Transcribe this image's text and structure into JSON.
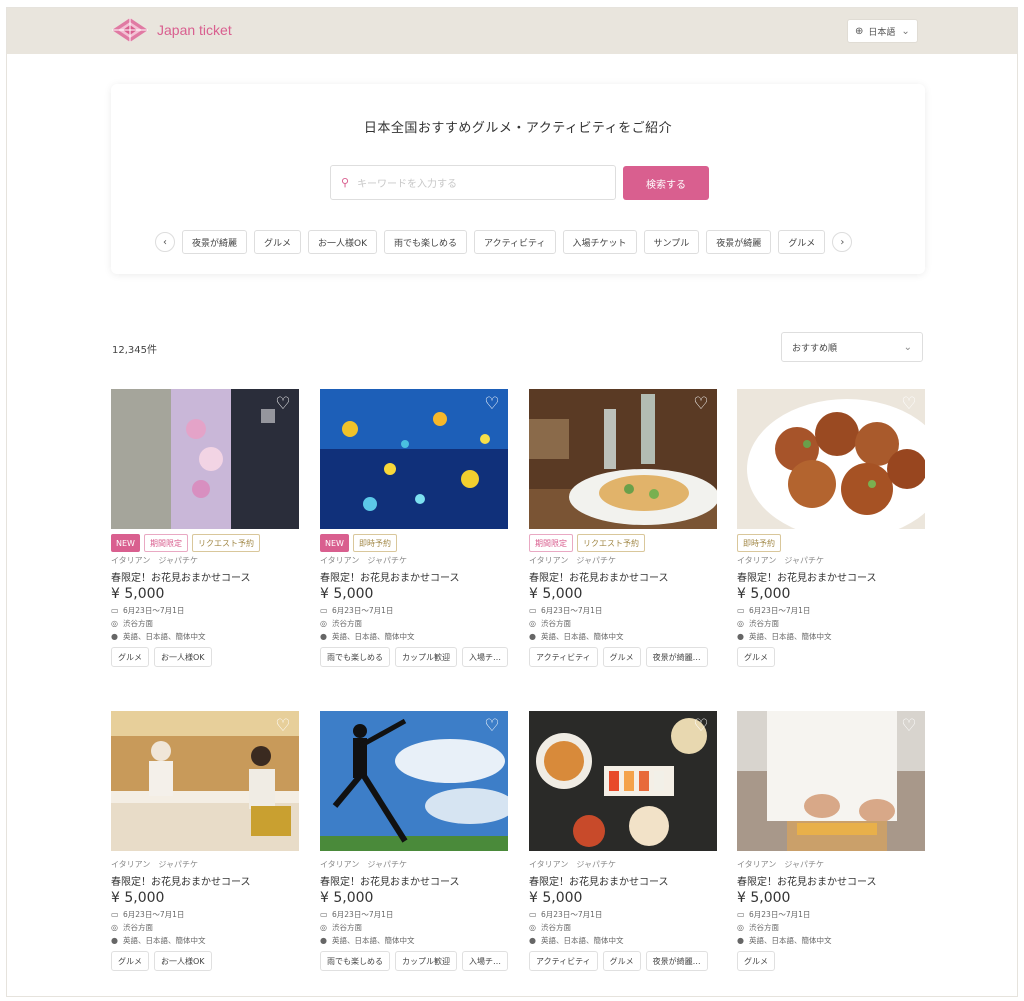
{
  "header": {
    "logo_text": "Japan ticket",
    "language": "日本語"
  },
  "search": {
    "title": "日本全国おすすめグルメ・アクティビティをご紹介",
    "placeholder": "キーワードを入力する",
    "button": "検索する",
    "chips": [
      "夜景が綺麗",
      "グルメ",
      "お一人様OK",
      "雨でも楽しめる",
      "アクティビティ",
      "入場チケット",
      "サンプル",
      "夜景が綺麗",
      "グルメ"
    ]
  },
  "results": {
    "count": "12,345件",
    "sort": "おすすめ順"
  },
  "colors": {
    "accent": "#d95f8f",
    "header_bg": "#e9e5dd"
  },
  "cards": [
    {
      "image": "kimono-flowers",
      "badges": [
        "NEW",
        "期間限定",
        "リクエスト予約"
      ],
      "category": "イタリアン　ジャパチケ",
      "title": "春限定！お花見おまかせコース",
      "price": "¥ 5,000",
      "date": "6月23日〜7月1日",
      "location": "渋谷方面",
      "languages": "英語、日本語、簡体中文",
      "tags": [
        "グルメ",
        "お一人様OK"
      ]
    },
    {
      "image": "aquarium-fish",
      "badges": [
        "NEW",
        "即時予約"
      ],
      "category": "イタリアン　ジャパチケ",
      "title": "春限定！お花見おまかせコース",
      "price": "¥ 5,000",
      "date": "6月23日〜7月1日",
      "location": "渋谷方面",
      "languages": "英語、日本語、簡体中文",
      "tags": [
        "雨でも楽しめる",
        "カップル歓迎",
        "入場チ…"
      ]
    },
    {
      "image": "pasta-dish",
      "badges": [
        "期間限定",
        "リクエスト予約"
      ],
      "category": "イタリアン　ジャパチケ",
      "title": "春限定！お花見おまかせコース",
      "price": "¥ 5,000",
      "date": "6月23日〜7月1日",
      "location": "渋谷方面",
      "languages": "英語、日本語、簡体中文",
      "tags": [
        "アクティビティ",
        "グルメ",
        "夜景が綺麗…"
      ]
    },
    {
      "image": "takoyaki",
      "badges": [
        "即時予約"
      ],
      "category": "イタリアン　ジャパチケ",
      "title": "春限定！お花見おまかせコース",
      "price": "¥ 5,000",
      "date": "6月23日〜7月1日",
      "location": "渋谷方面",
      "languages": "英語、日本語、簡体中文",
      "tags": [
        "グルメ"
      ]
    },
    {
      "image": "sushi-counter",
      "badges": [],
      "category": "イタリアン　ジャパチケ",
      "title": "春限定！お花見おまかせコース",
      "price": "¥ 5,000",
      "date": "6月23日〜7月1日",
      "location": "渋谷方面",
      "languages": "英語、日本語、簡体中文",
      "tags": [
        "グルメ",
        "お一人様OK"
      ]
    },
    {
      "image": "ninja-jump",
      "badges": [],
      "category": "イタリアン　ジャパチケ",
      "title": "春限定！お花見おまかせコース",
      "price": "¥ 5,000",
      "date": "6月23日〜7月1日",
      "location": "渋谷方面",
      "languages": "英語、日本語、簡体中文",
      "tags": [
        "雨でも楽しめる",
        "カップル歓迎",
        "入場チ…"
      ]
    },
    {
      "image": "food-table",
      "badges": [],
      "category": "イタリアン　ジャパチケ",
      "title": "春限定！お花見おまかせコース",
      "price": "¥ 5,000",
      "date": "6月23日〜7月1日",
      "location": "渋谷方面",
      "languages": "英語、日本語、簡体中文",
      "tags": [
        "アクティビティ",
        "グルメ",
        "夜景が綺麗…"
      ]
    },
    {
      "image": "chef-sushi",
      "badges": [],
      "category": "イタリアン　ジャパチケ",
      "title": "春限定！お花見おまかせコース",
      "price": "¥ 5,000",
      "date": "6月23日〜7月1日",
      "location": "渋谷方面",
      "languages": "英語、日本語、簡体中文",
      "tags": [
        "グルメ"
      ]
    }
  ]
}
